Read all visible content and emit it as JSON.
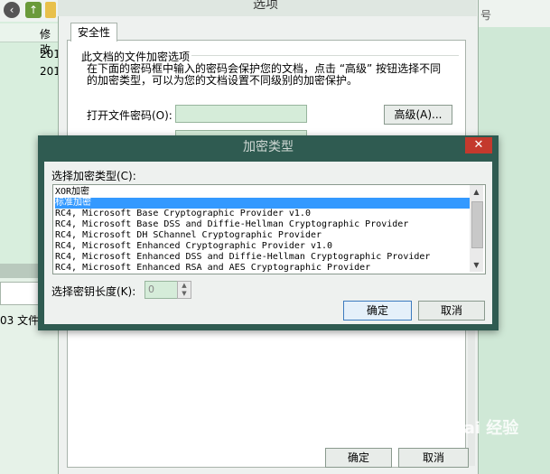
{
  "background": {
    "col_header": "修改",
    "rows": [
      "201",
      "201"
    ],
    "status_text": "03 文件",
    "right_header": "号"
  },
  "options_dialog": {
    "title": "选项",
    "tab": "安全性",
    "group_title": "此文档的文件加密选项",
    "description": "在下面的密码框中输入的密码会保护您的文档，点击 “高级” 按钮选择不同的加密类型，可以为您的文档设置不同级别的加密保护。",
    "open_password_label": "打开文件密码(O):",
    "advanced_button": "高级(A)...",
    "ok": "确定",
    "cancel": "取消"
  },
  "enc_dialog": {
    "title": "加密类型",
    "close": "✕",
    "list_label": "选择加密类型(C):",
    "items": [
      "XOR加密",
      "标准加密",
      "RC4, Microsoft Base Cryptographic Provider v1.0",
      "RC4, Microsoft Base DSS and Diffie-Hellman Cryptographic Provider",
      "RC4, Microsoft DH SChannel Cryptographic Provider",
      "RC4, Microsoft Enhanced Cryptographic Provider v1.0",
      "RC4, Microsoft Enhanced DSS and Diffie-Hellman Cryptographic Provider",
      "RC4, Microsoft Enhanced RSA and AES Cryptographic Provider"
    ],
    "selected_index": 1,
    "key_length_label": "选择密钥长度(K):",
    "key_length_value": "0",
    "ok": "确定",
    "cancel": "取消"
  },
  "watermark": "Bai 经验",
  "colors": {
    "accent": "#3399ff",
    "dialog_frame": "#2f5b51",
    "close": "#c4392d"
  }
}
